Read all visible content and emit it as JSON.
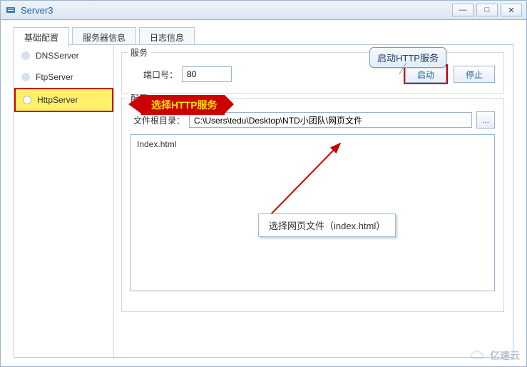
{
  "window": {
    "title": "Server3"
  },
  "tabs": [
    {
      "label": "基础配置",
      "active": true
    },
    {
      "label": "服务器信息",
      "active": false
    },
    {
      "label": "日志信息",
      "active": false
    }
  ],
  "sidebar": {
    "items": [
      {
        "label": "DNSServer",
        "active": false
      },
      {
        "label": "FtpServer",
        "active": false
      },
      {
        "label": "HttpServer",
        "active": true
      }
    ]
  },
  "service": {
    "legend": "服务",
    "port_label": "端口号：",
    "port_value": "80",
    "start_label": "启动",
    "stop_label": "停止"
  },
  "config": {
    "legend": "配置",
    "root_label": "文件根目录：",
    "root_value": "C:\\Users\\tedu\\Desktop\\NTD小团队\\网页文件",
    "browse_label": "...",
    "file_list": [
      "Index.html"
    ]
  },
  "annotations": {
    "start_callout": "启动HTTP服务",
    "select_http": "选择HTTP服务",
    "select_file": "选择网页文件（index.html）"
  },
  "watermark": "亿速云"
}
